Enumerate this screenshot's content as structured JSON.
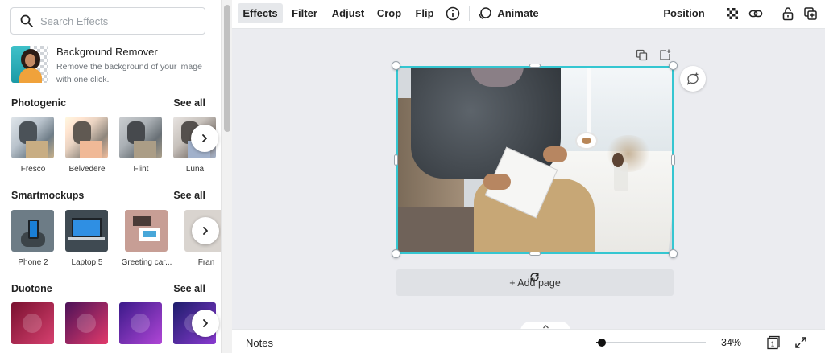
{
  "search": {
    "placeholder": "Search Effects"
  },
  "background_remover": {
    "title": "Background Remover",
    "description": "Remove the background of your image with one click."
  },
  "sections": [
    {
      "title": "Photogenic",
      "see_all": "See all",
      "items": [
        {
          "label": "Fresco"
        },
        {
          "label": "Belvedere"
        },
        {
          "label": "Flint"
        },
        {
          "label": "Luna"
        }
      ]
    },
    {
      "title": "Smartmockups",
      "see_all": "See all",
      "items": [
        {
          "label": "Phone 2"
        },
        {
          "label": "Laptop 5"
        },
        {
          "label": "Greeting car..."
        },
        {
          "label": "Fran"
        }
      ]
    },
    {
      "title": "Duotone",
      "see_all": "See all",
      "items": [
        {
          "label": ""
        },
        {
          "label": ""
        },
        {
          "label": ""
        },
        {
          "label": ""
        }
      ]
    }
  ],
  "toolbar": {
    "effects": "Effects",
    "filter": "Filter",
    "adjust": "Adjust",
    "crop": "Crop",
    "flip": "Flip",
    "animate": "Animate",
    "position": "Position"
  },
  "canvas": {
    "add_page": "+ Add page"
  },
  "footer": {
    "notes": "Notes",
    "zoom": "34%",
    "zoom_fraction": 0.05,
    "page_count": "1"
  },
  "icons": {
    "search": "search-icon",
    "info": "info-icon",
    "animate": "animate-icon",
    "transparency": "transparency-icon",
    "link": "link-icon",
    "lock": "lock-icon",
    "duplicate": "duplicate-icon",
    "add_page": "add-page-icon",
    "comment": "comment-icon",
    "rotate": "rotate-icon",
    "chevron_right": "chevron-right-icon",
    "chevron_up": "chevron-up-icon",
    "pages": "pages-icon",
    "fullscreen": "fullscreen-icon"
  },
  "colors": {
    "selection": "#35c6d1",
    "canvas_bg": "#ebecf0",
    "active_tab_bg": "#e6e8eb"
  }
}
